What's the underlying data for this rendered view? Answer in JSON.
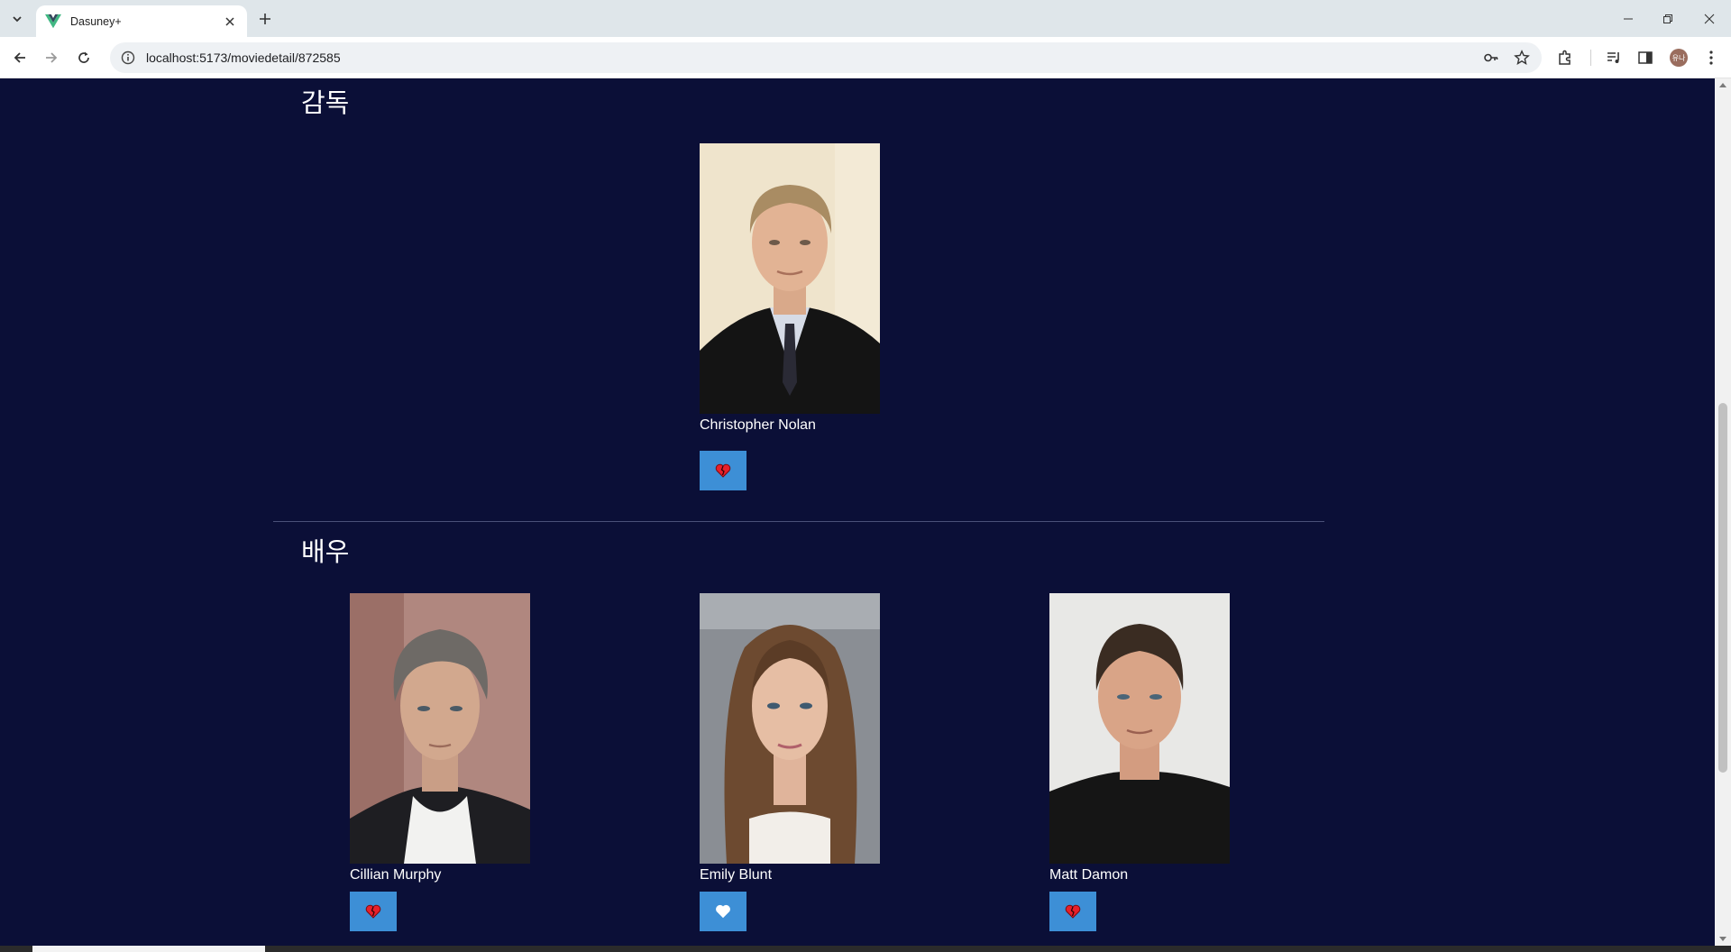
{
  "browser": {
    "tab_title": "Dasuney+",
    "url": "localhost:5173/moviedetail/872585",
    "profile_initials": "유나"
  },
  "directors": {
    "title": "감독",
    "people": [
      {
        "name": "Christopher Nolan",
        "liked": true
      }
    ]
  },
  "actors": {
    "title": "배우",
    "people": [
      {
        "name": "Cillian Murphy",
        "liked": true
      },
      {
        "name": "Emily Blunt",
        "liked": false
      },
      {
        "name": "Matt Damon",
        "liked": true
      }
    ]
  },
  "colors": {
    "page_bg": "#0b0f37",
    "like_button": "#3d8fd6",
    "heart_liked": "#e8202a"
  }
}
